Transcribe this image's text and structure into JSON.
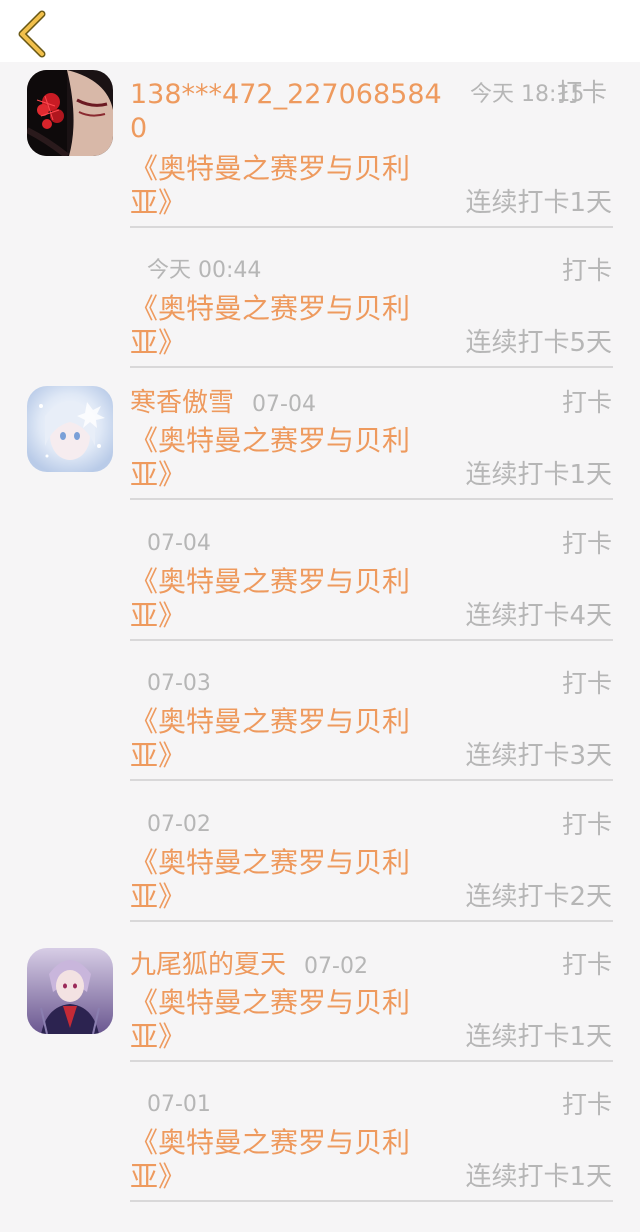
{
  "header": {
    "back_icon": "chevron-left-icon",
    "accent_color": "#f2c04b"
  },
  "colors": {
    "accent_orange": "#ee9a5e",
    "muted_gray": "#b6b6b6",
    "background": "#f6f5f6",
    "divider": "#d9d8d9"
  },
  "entries": [
    {
      "username": "138***472_2270685840",
      "time": "今天 18:15",
      "action": "打卡",
      "book": "《奥特曼之赛罗与贝利亚》",
      "streak": "连续打卡1天"
    },
    {
      "time": "今天 00:44",
      "action": "打卡",
      "book": "《奥特曼之赛罗与贝利亚》",
      "streak": "连续打卡5天"
    },
    {
      "username": "寒香傲雪",
      "time": "07-04",
      "action": "打卡",
      "book": "《奥特曼之赛罗与贝利亚》",
      "streak": "连续打卡1天"
    },
    {
      "time": "07-04",
      "action": "打卡",
      "book": "《奥特曼之赛罗与贝利亚》",
      "streak": "连续打卡4天"
    },
    {
      "time": "07-03",
      "action": "打卡",
      "book": "《奥特曼之赛罗与贝利亚》",
      "streak": "连续打卡3天"
    },
    {
      "time": "07-02",
      "action": "打卡",
      "book": "《奥特曼之赛罗与贝利亚》",
      "streak": "连续打卡2天"
    },
    {
      "username": "九尾狐的夏天",
      "time": "07-02",
      "action": "打卡",
      "book": "《奥特曼之赛罗与贝利亚》",
      "streak": "连续打卡1天"
    },
    {
      "time": "07-01",
      "action": "打卡",
      "book": "《奥特曼之赛罗与贝利亚》",
      "streak": "连续打卡1天"
    }
  ]
}
